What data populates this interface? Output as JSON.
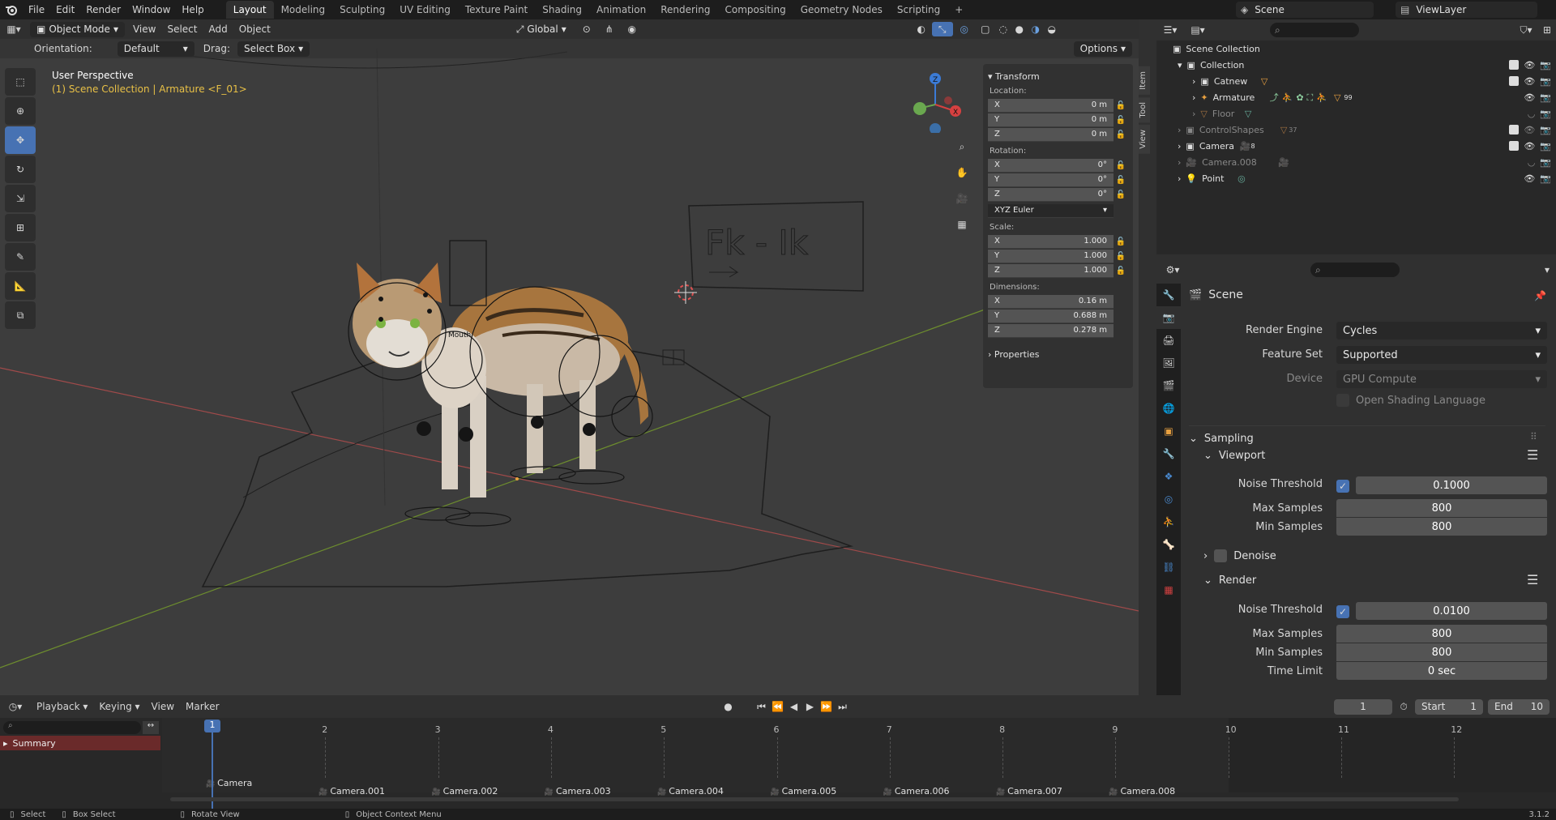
{
  "menu": [
    "File",
    "Edit",
    "Render",
    "Window",
    "Help"
  ],
  "workspaces": [
    "Layout",
    "Modeling",
    "Sculpting",
    "UV Editing",
    "Texture Paint",
    "Shading",
    "Animation",
    "Rendering",
    "Compositing",
    "Geometry Nodes",
    "Scripting"
  ],
  "active_workspace": "Layout",
  "scene_name": "Scene",
  "view_layer": "ViewLayer",
  "viewport": {
    "mode": "Object Mode",
    "menus": [
      "View",
      "Select",
      "Add",
      "Object"
    ],
    "transform_orientation": "Global",
    "orientation_label": "Orientation:",
    "orientation_value": "Default",
    "drag_label": "Drag:",
    "drag_value": "Select Box",
    "options": "Options",
    "perspective": "User Perspective",
    "context": "(1) Scene Collection | Armature <F_01>",
    "sign_text": "Fk - Ik",
    "mouth_label": "Mouth"
  },
  "npanel": {
    "tabs": [
      "Item",
      "Tool",
      "View"
    ],
    "header": "Transform",
    "location_label": "Location:",
    "location": [
      {
        "axis": "X",
        "value": "0 m"
      },
      {
        "axis": "Y",
        "value": "0 m"
      },
      {
        "axis": "Z",
        "value": "0 m"
      }
    ],
    "rotation_label": "Rotation:",
    "rotation": [
      {
        "axis": "X",
        "value": "0°"
      },
      {
        "axis": "Y",
        "value": "0°"
      },
      {
        "axis": "Z",
        "value": "0°"
      }
    ],
    "rotation_mode": "XYZ Euler",
    "scale_label": "Scale:",
    "scale": [
      {
        "axis": "X",
        "value": "1.000"
      },
      {
        "axis": "Y",
        "value": "1.000"
      },
      {
        "axis": "Z",
        "value": "1.000"
      }
    ],
    "dimensions_label": "Dimensions:",
    "dimensions": [
      {
        "axis": "X",
        "value": "0.16 m"
      },
      {
        "axis": "Y",
        "value": "0.688 m"
      },
      {
        "axis": "Z",
        "value": "0.278 m"
      }
    ],
    "properties": "Properties"
  },
  "outliner": {
    "root": "Scene Collection",
    "items": [
      {
        "name": "Collection",
        "badge": ""
      },
      {
        "name": "Catnew",
        "badge": ""
      },
      {
        "name": "Armature",
        "badge": "99"
      },
      {
        "name": "Floor",
        "badge": ""
      },
      {
        "name": "ControlShapes",
        "badge": "37"
      },
      {
        "name": "Camera",
        "badge": "8"
      },
      {
        "name": "Camera.008",
        "badge": ""
      },
      {
        "name": "Point",
        "badge": ""
      }
    ]
  },
  "properties": {
    "title": "Scene",
    "render_engine_label": "Render Engine",
    "render_engine": "Cycles",
    "feature_set_label": "Feature Set",
    "feature_set": "Supported",
    "device_label": "Device",
    "device": "GPU Compute",
    "osl_label": "Open Shading Language",
    "sampling": "Sampling",
    "viewport": "Viewport",
    "noise_threshold_label": "Noise Threshold",
    "viewport_noise": "0.1000",
    "max_samples_label": "Max Samples",
    "viewport_max": "800",
    "min_samples_label": "Min Samples",
    "viewport_min": "800",
    "denoise": "Denoise",
    "render": "Render",
    "render_noise": "0.0100",
    "render_max": "800",
    "render_min": "800",
    "time_limit_label": "Time Limit",
    "time_limit": "0 sec"
  },
  "timeline": {
    "menus": [
      "Playback",
      "Keying",
      "View",
      "Marker"
    ],
    "current_frame": "1",
    "start_label": "Start",
    "start": "1",
    "end_label": "End",
    "end": "10",
    "summary": "Summary",
    "frames": [
      "1",
      "2",
      "3",
      "4",
      "5",
      "6",
      "7",
      "8",
      "9",
      "10",
      "11",
      "12"
    ],
    "cameras": [
      "Camera",
      "Camera.001",
      "Camera.002",
      "Camera.003",
      "Camera.004",
      "Camera.005",
      "Camera.006",
      "Camera.007",
      "Camera.008"
    ]
  },
  "status": {
    "select": "Select",
    "box_select": "Box Select",
    "rotate_view": "Rotate View",
    "context_menu": "Object Context Menu",
    "version": "3.1.2"
  }
}
